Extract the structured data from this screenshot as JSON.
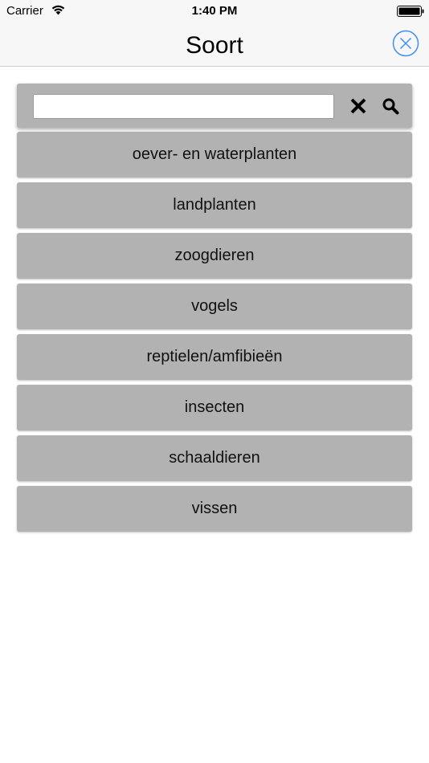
{
  "status_bar": {
    "carrier": "Carrier",
    "time": "1:40 PM",
    "icons": [
      "wifi-icon",
      "battery-icon"
    ]
  },
  "nav": {
    "title": "Soort",
    "close_icon": "close-circle-icon",
    "accent_color": "#3d8ef5"
  },
  "search": {
    "value": "",
    "placeholder": "",
    "clear_icon": "clear-icon",
    "search_icon": "search-icon"
  },
  "categories": [
    {
      "label": "oever- en waterplanten"
    },
    {
      "label": "landplanten"
    },
    {
      "label": "zoogdieren"
    },
    {
      "label": "vogels"
    },
    {
      "label": "reptielen/amfibieën"
    },
    {
      "label": "insecten"
    },
    {
      "label": "schaaldieren"
    },
    {
      "label": "vissen"
    }
  ],
  "colors": {
    "button_bg": "#b2b2b2",
    "bar_bg": "#f7f7f7"
  }
}
